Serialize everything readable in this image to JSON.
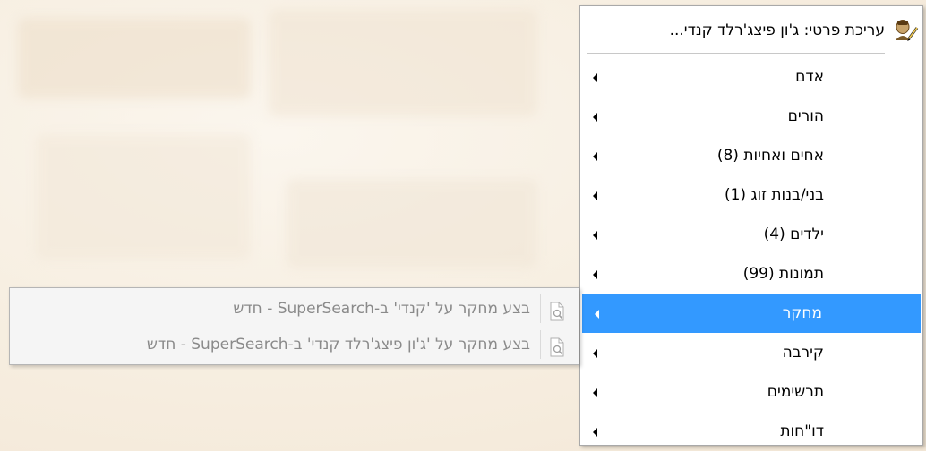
{
  "menu": {
    "header": {
      "icon": "edit-person-icon",
      "title": "עריכת פרטי: ג'ון פיצג'רלד קנדי..."
    },
    "items": [
      {
        "label": "אדם",
        "has_submenu": true,
        "active": false
      },
      {
        "label": "הורים",
        "has_submenu": true,
        "active": false
      },
      {
        "label": "אחים ואחיות (8)",
        "has_submenu": true,
        "active": false
      },
      {
        "label": "בני/בנות זוג (1)",
        "has_submenu": true,
        "active": false
      },
      {
        "label": "ילדים (4)",
        "has_submenu": true,
        "active": false
      },
      {
        "label": "תמונות (99)",
        "has_submenu": true,
        "active": false
      },
      {
        "label": "מחקר",
        "has_submenu": true,
        "active": true
      },
      {
        "label": "קירבה",
        "has_submenu": true,
        "active": false
      },
      {
        "label": "תרשימים",
        "has_submenu": true,
        "active": false
      },
      {
        "label": "דו\"חות",
        "has_submenu": true,
        "active": false
      }
    ]
  },
  "submenu": {
    "items": [
      {
        "icon": "document-search-icon",
        "label": "בצע מחקר על 'קנדי' ב-SuperSearch - חדש"
      },
      {
        "icon": "document-search-icon",
        "label": "בצע מחקר על 'ג'ון פיצג'רלד קנדי' ב-SuperSearch - חדש"
      }
    ]
  },
  "colors": {
    "highlight": "#3399ff",
    "disabled_text": "#8a8a8a"
  }
}
